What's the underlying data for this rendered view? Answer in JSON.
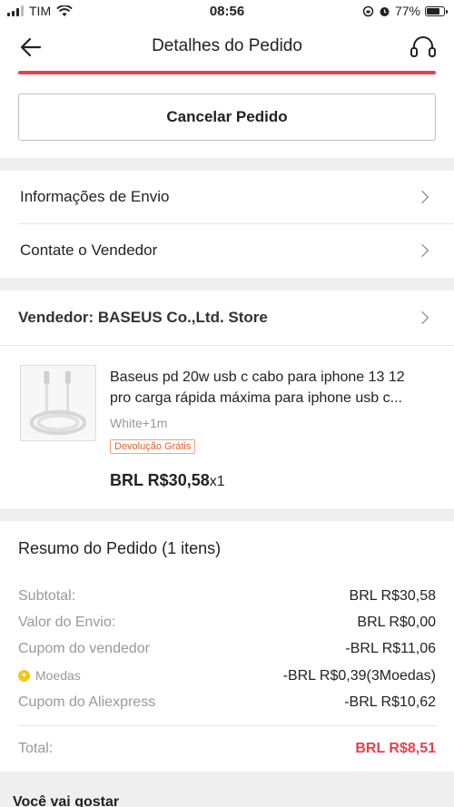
{
  "status_bar": {
    "carrier": "TIM",
    "time": "08:56",
    "battery": "77%"
  },
  "header": {
    "title": "Detalhes do Pedido"
  },
  "actions": {
    "cancel_label": "Cancelar Pedido"
  },
  "links": {
    "shipping_info": "Informações de Envio",
    "contact_seller": "Contate o Vendedor"
  },
  "vendor": {
    "label": "Vendedor: BASEUS Co.,Ltd. Store"
  },
  "product": {
    "title_line1": "Baseus pd 20w usb c cabo para iphone 13 12",
    "title_line2": "pro carga rápida máxima para iphone usb c...",
    "variant": "White+1m",
    "badge": "Devolução Grátis",
    "price": "BRL R$30,58",
    "quantity": "x1"
  },
  "summary": {
    "title": "Resumo do Pedido (1 itens)",
    "rows": [
      {
        "label": "Subtotal:",
        "value": "BRL R$30,58"
      },
      {
        "label": "Valor do Envio:",
        "value": "BRL R$0,00"
      },
      {
        "label": "Cupom do vendedor",
        "value": "-BRL R$11,06"
      },
      {
        "label": "Moedas",
        "value": "-BRL R$0,39(3Moedas)"
      },
      {
        "label": "Cupom do Aliexpress",
        "value": "-BRL R$10,62"
      }
    ],
    "total_label": "Total:",
    "total_value": "BRL R$8,51",
    "accent_color": "#e8404a"
  },
  "recommendations": {
    "title": "Você vai gostar"
  }
}
